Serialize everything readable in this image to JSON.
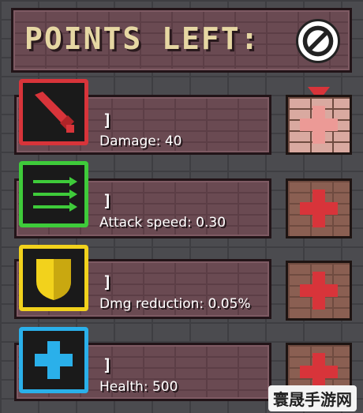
{
  "header": {
    "title": "POINTS LEFT:"
  },
  "stats": [
    {
      "id": "damage",
      "label": "Damage: 40",
      "bracket": "]",
      "icon": "sword-icon",
      "accent": "#d8343a"
    },
    {
      "id": "attack-speed",
      "label": "Attack speed: 0.30",
      "bracket": "]",
      "icon": "arrows-icon",
      "accent": "#3ecb3a"
    },
    {
      "id": "dmg-reduction",
      "label": "Dmg reduction: 0.05%",
      "bracket": "]",
      "icon": "shield-icon",
      "accent": "#f2d21c"
    },
    {
      "id": "health",
      "label": "Health: 500",
      "bracket": "]",
      "icon": "health-cross-icon",
      "accent": "#2ab0ea"
    }
  ],
  "colors": {
    "plus": "#d8343a"
  },
  "watermark": {
    "text": "寰晟手游网"
  }
}
